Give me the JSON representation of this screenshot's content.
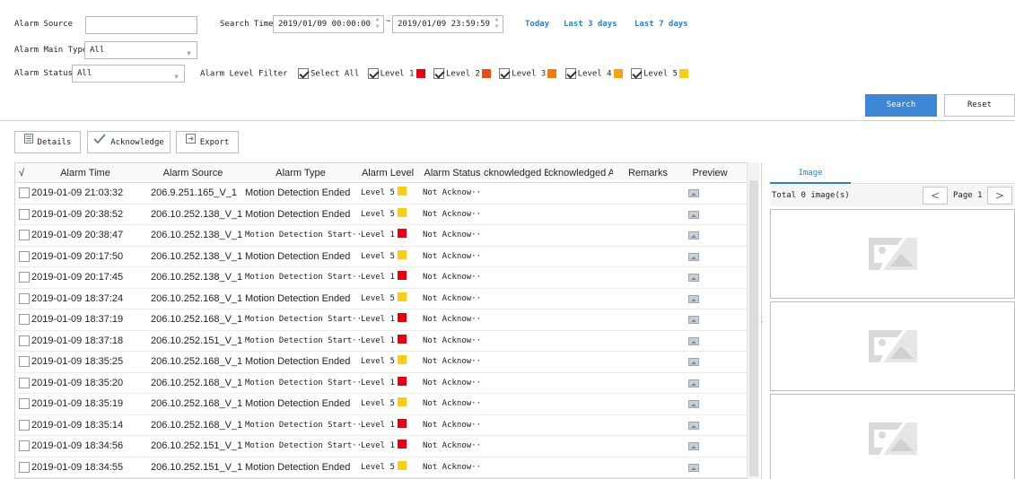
{
  "filters": {
    "alarm_source_label": "Alarm Source",
    "alarm_source_value": "",
    "search_time_label": "Search Time",
    "start_time": "2019/01/09 00:00:00",
    "end_time": "2019/01/09 23:59:59",
    "range_sep": "~",
    "quick_ranges": [
      "Today",
      "Last 3 days",
      "Last 7 days"
    ],
    "main_type_label": "Alarm Main Type",
    "main_type_value": "All",
    "status_label": "Alarm Status",
    "status_value": "All",
    "level_filter_label": "Alarm Level Filter",
    "select_all_label": "Select All",
    "levels": [
      {
        "label": "Level 1",
        "color": "#e60012",
        "checked": true
      },
      {
        "label": "Level 2",
        "color": "#ee4b14",
        "checked": true
      },
      {
        "label": "Level 3",
        "color": "#f07a10",
        "checked": true
      },
      {
        "label": "Level 4",
        "color": "#f5a316",
        "checked": true
      },
      {
        "label": "Level 5",
        "color": "#fbcd16",
        "checked": true
      }
    ],
    "search_label": "Search",
    "reset_label": "Reset"
  },
  "toolbar": {
    "details_label": "Details",
    "acknowledge_label": "Acknowledge",
    "export_label": "Export"
  },
  "table": {
    "columns": [
      "√",
      "Alarm Time",
      "Alarm Source",
      "Alarm Type",
      "Alarm Level",
      "Alarm Status",
      "cknowledged B",
      "cknowledged A",
      "Remarks",
      "Preview"
    ],
    "rows": [
      {
        "time": "2019-01-09 21:03:32",
        "source": "206.9.251.165_V_1",
        "type": "Motion Detection Ended",
        "level": "Level 5",
        "status": "Not Acknow···"
      },
      {
        "time": "2019-01-09 20:38:52",
        "source": "206.10.252.138_V_1",
        "type": "Motion Detection Ended",
        "level": "Level 5",
        "status": "Not Acknow···"
      },
      {
        "time": "2019-01-09 20:38:47",
        "source": "206.10.252.138_V_1",
        "type": "Motion Detection Start···",
        "level": "Level 1",
        "status": "Not Acknow···"
      },
      {
        "time": "2019-01-09 20:17:50",
        "source": "206.10.252.138_V_1",
        "type": "Motion Detection Ended",
        "level": "Level 5",
        "status": "Not Acknow···"
      },
      {
        "time": "2019-01-09 20:17:45",
        "source": "206.10.252.138_V_1",
        "type": "Motion Detection Start···",
        "level": "Level 1",
        "status": "Not Acknow···"
      },
      {
        "time": "2019-01-09 18:37:24",
        "source": "206.10.252.168_V_1",
        "type": "Motion Detection Ended",
        "level": "Level 5",
        "status": "Not Acknow···"
      },
      {
        "time": "2019-01-09 18:37:19",
        "source": "206.10.252.168_V_1",
        "type": "Motion Detection Start···",
        "level": "Level 1",
        "status": "Not Acknow···"
      },
      {
        "time": "2019-01-09 18:37:18",
        "source": "206.10.252.151_V_1",
        "type": "Motion Detection Start···",
        "level": "Level 1",
        "status": "Not Acknow···"
      },
      {
        "time": "2019-01-09 18:35:25",
        "source": "206.10.252.168_V_1",
        "type": "Motion Detection Ended",
        "level": "Level 5",
        "status": "Not Acknow···"
      },
      {
        "time": "2019-01-09 18:35:20",
        "source": "206.10.252.168_V_1",
        "type": "Motion Detection Start···",
        "level": "Level 1",
        "status": "Not Acknow···"
      },
      {
        "time": "2019-01-09 18:35:19",
        "source": "206.10.252.168_V_1",
        "type": "Motion Detection Ended",
        "level": "Level 5",
        "status": "Not Acknow···"
      },
      {
        "time": "2019-01-09 18:35:14",
        "source": "206.10.252.168_V_1",
        "type": "Motion Detection Start···",
        "level": "Level 1",
        "status": "Not Acknow···"
      },
      {
        "time": "2019-01-09 18:34:56",
        "source": "206.10.252.151_V_1",
        "type": "Motion Detection Start···",
        "level": "Level 1",
        "status": "Not Acknow···"
      },
      {
        "time": "2019-01-09 18:34:55",
        "source": "206.10.252.151_V_1",
        "type": "Motion Detection Ended",
        "level": "Level 5",
        "status": "Not Acknow···"
      }
    ]
  },
  "image_pane": {
    "tab_label": "Image",
    "total_label": "Total 0 image(s)",
    "page_label": "Page 1",
    "prev_glyph": "<",
    "next_glyph": ">"
  },
  "icons": {
    "details": "details-icon",
    "acknowledge": "check-icon",
    "export": "export-icon",
    "preview": "image-icon",
    "placeholder": "image-placeholder-icon"
  }
}
